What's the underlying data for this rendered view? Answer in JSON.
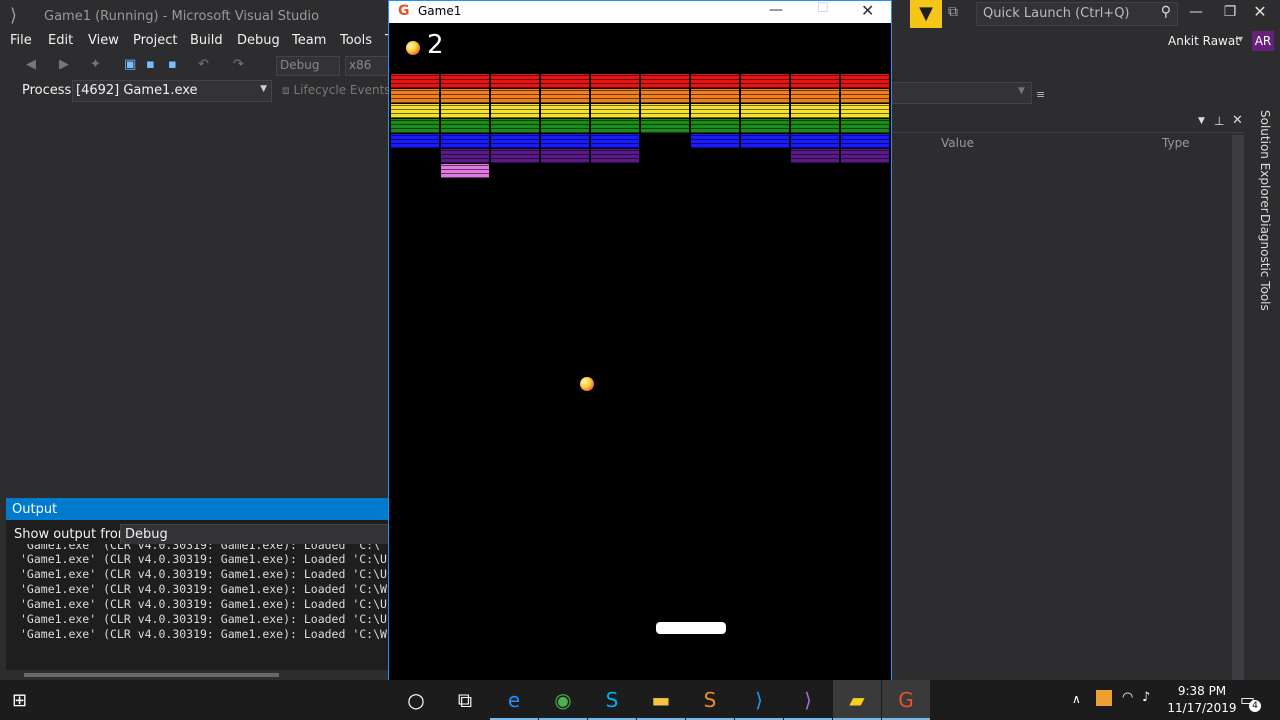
{
  "vs": {
    "title": "Game1 (Running) - Microsoft Visual Studio",
    "menu": [
      "File",
      "Edit",
      "View",
      "Project",
      "Build",
      "Debug",
      "Team",
      "Tools",
      "T"
    ],
    "quick_launch_placeholder": "Quick Launch (Ctrl+Q)",
    "user_name": "Ankit Rawat",
    "user_initials": "AR",
    "config": "Debug",
    "platform": "x86",
    "process_label": "Process:",
    "process_value": "[4692] Game1.exe",
    "lifecycle_label": "Lifecycle Events",
    "locals_columns": [
      "Value",
      "Type"
    ],
    "side_tabs": [
      "Solution Explorer",
      "Diagnostic Tools"
    ]
  },
  "output": {
    "title": "Output",
    "show_from_label": "Show output from:",
    "show_from_value": "Debug",
    "lines": [
      "'Game1.exe' (CLR v4.0.30319: Game1.exe): Loaded 'C:\\",
      "'Game1.exe' (CLR v4.0.30319: Game1.exe): Loaded 'C:\\U",
      "'Game1.exe' (CLR v4.0.30319: Game1.exe): Loaded 'C:\\U",
      "'Game1.exe' (CLR v4.0.30319: Game1.exe): Loaded 'C:\\W",
      "'Game1.exe' (CLR v4.0.30319: Game1.exe): Loaded 'C:\\U",
      "'Game1.exe' (CLR v4.0.30319: Game1.exe): Loaded 'C:\\U",
      "'Game1.exe' (CLR v4.0.30319: Game1.exe): Loaded 'C:\\W"
    ]
  },
  "game": {
    "window_title": "Game1",
    "lives": "2",
    "brick_colors": [
      "#e81414",
      "#f07f1e",
      "#f5e02a",
      "#1a8c1a",
      "#1a1aff",
      "#5b1a8c",
      "#e07ae0"
    ],
    "brick_rows": [
      {
        "color": "#e81414",
        "present": [
          1,
          1,
          1,
          1,
          1,
          1,
          1,
          1,
          1,
          1
        ]
      },
      {
        "color": "#f07f1e",
        "present": [
          1,
          1,
          1,
          1,
          1,
          1,
          1,
          1,
          1,
          1
        ]
      },
      {
        "color": "#f5e02a",
        "present": [
          1,
          1,
          1,
          1,
          1,
          1,
          1,
          1,
          1,
          1
        ]
      },
      {
        "color": "#1a8c1a",
        "present": [
          1,
          1,
          1,
          1,
          1,
          1,
          1,
          1,
          1,
          1
        ]
      },
      {
        "color": "#1a1aff",
        "present": [
          1,
          1,
          1,
          1,
          1,
          0,
          1,
          1,
          1,
          1
        ]
      },
      {
        "color": "#5b1a8c",
        "present": [
          0,
          1,
          1,
          1,
          1,
          0,
          0,
          0,
          1,
          1
        ]
      },
      {
        "color": "#e07ae0",
        "present": [
          0,
          1,
          0,
          0,
          0,
          0,
          0,
          0,
          0,
          0
        ]
      }
    ]
  },
  "taskbar": {
    "time": "9:38 PM",
    "date": "11/17/2019",
    "notifications": "4",
    "apps": [
      {
        "name": "cortana",
        "glyph": "○",
        "color": "#ffffff"
      },
      {
        "name": "task-view",
        "glyph": "⧉",
        "color": "#ffffff"
      },
      {
        "name": "edge",
        "glyph": "e",
        "color": "#1e90ff"
      },
      {
        "name": "chrome",
        "glyph": "◉",
        "color": "#4caf50"
      },
      {
        "name": "skype",
        "glyph": "S",
        "color": "#00aff0"
      },
      {
        "name": "file-explorer",
        "glyph": "▬",
        "color": "#f5c542"
      },
      {
        "name": "sublime",
        "glyph": "S",
        "color": "#f08a24"
      },
      {
        "name": "vscode",
        "glyph": "⟩",
        "color": "#2196f3"
      },
      {
        "name": "visual-studio",
        "glyph": "⟩",
        "color": "#a070d0"
      },
      {
        "name": "sticky-notes",
        "glyph": "▰",
        "color": "#f5d020"
      },
      {
        "name": "monogame",
        "glyph": "G",
        "color": "#e8512a"
      }
    ]
  }
}
